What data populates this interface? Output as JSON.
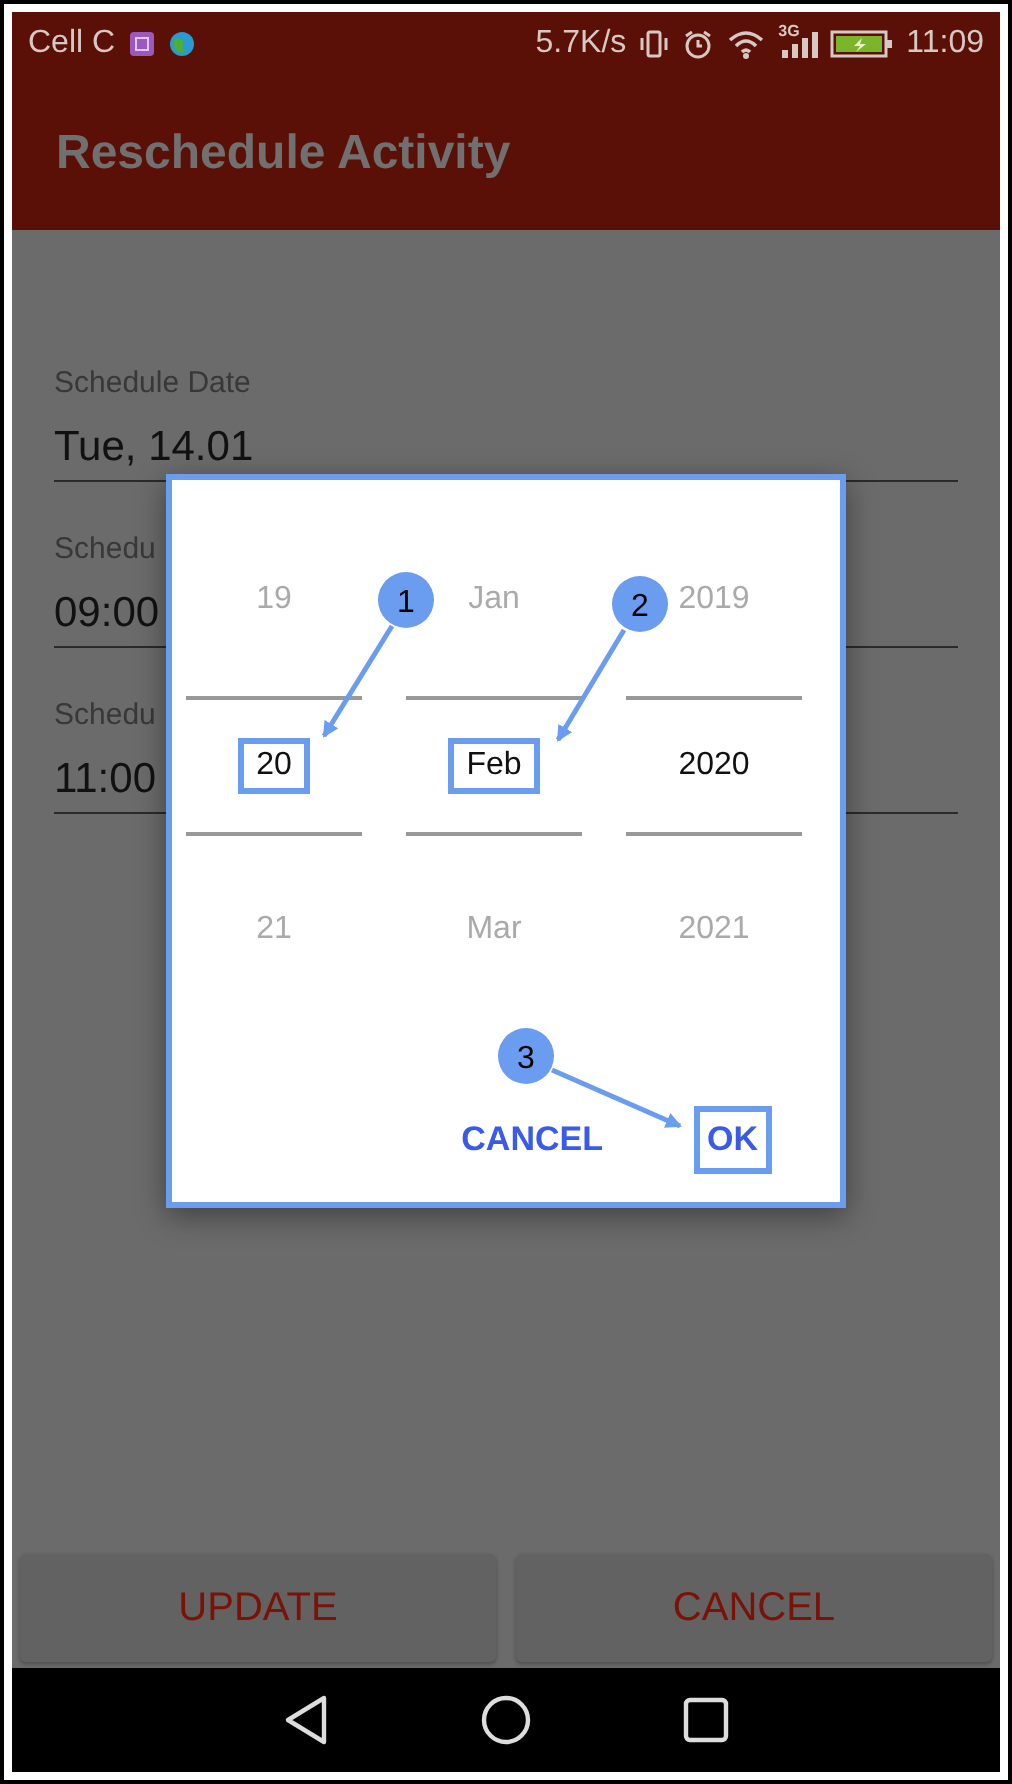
{
  "status_bar": {
    "carrier": "Cell C",
    "speed": "5.7K/s",
    "network": "3G",
    "time": "11:09"
  },
  "app_bar": {
    "title": "Reschedule Activity"
  },
  "fields": [
    {
      "label": "Schedule Date",
      "value": "Tue, 14.01"
    },
    {
      "label": "Schedu",
      "value": "09:00"
    },
    {
      "label": "Schedu",
      "value": "11:00"
    }
  ],
  "buttons": [
    "UPDATE",
    "CANCEL"
  ],
  "dialog": {
    "columns": [
      {
        "items": [
          {
            "text": "19",
            "selected": false,
            "highlighted": false
          },
          {
            "text": "20",
            "selected": true,
            "highlighted": true
          },
          {
            "text": "21",
            "selected": false,
            "highlighted": false
          }
        ]
      },
      {
        "items": [
          {
            "text": "Jan",
            "selected": false,
            "highlighted": false
          },
          {
            "text": "Feb",
            "selected": true,
            "highlighted": true
          },
          {
            "text": "Mar",
            "selected": false,
            "highlighted": false
          }
        ]
      },
      {
        "items": [
          {
            "text": "2019",
            "selected": false,
            "highlighted": false
          },
          {
            "text": "2020",
            "selected": true,
            "highlighted": false
          },
          {
            "text": "2021",
            "selected": false,
            "highlighted": false
          }
        ]
      }
    ],
    "actions": [
      {
        "label": "CANCEL",
        "highlighted": false
      },
      {
        "label": "OK",
        "highlighted": true
      }
    ]
  },
  "annotations": [
    {
      "number": "1"
    },
    {
      "number": "2"
    },
    {
      "number": "3"
    }
  ]
}
